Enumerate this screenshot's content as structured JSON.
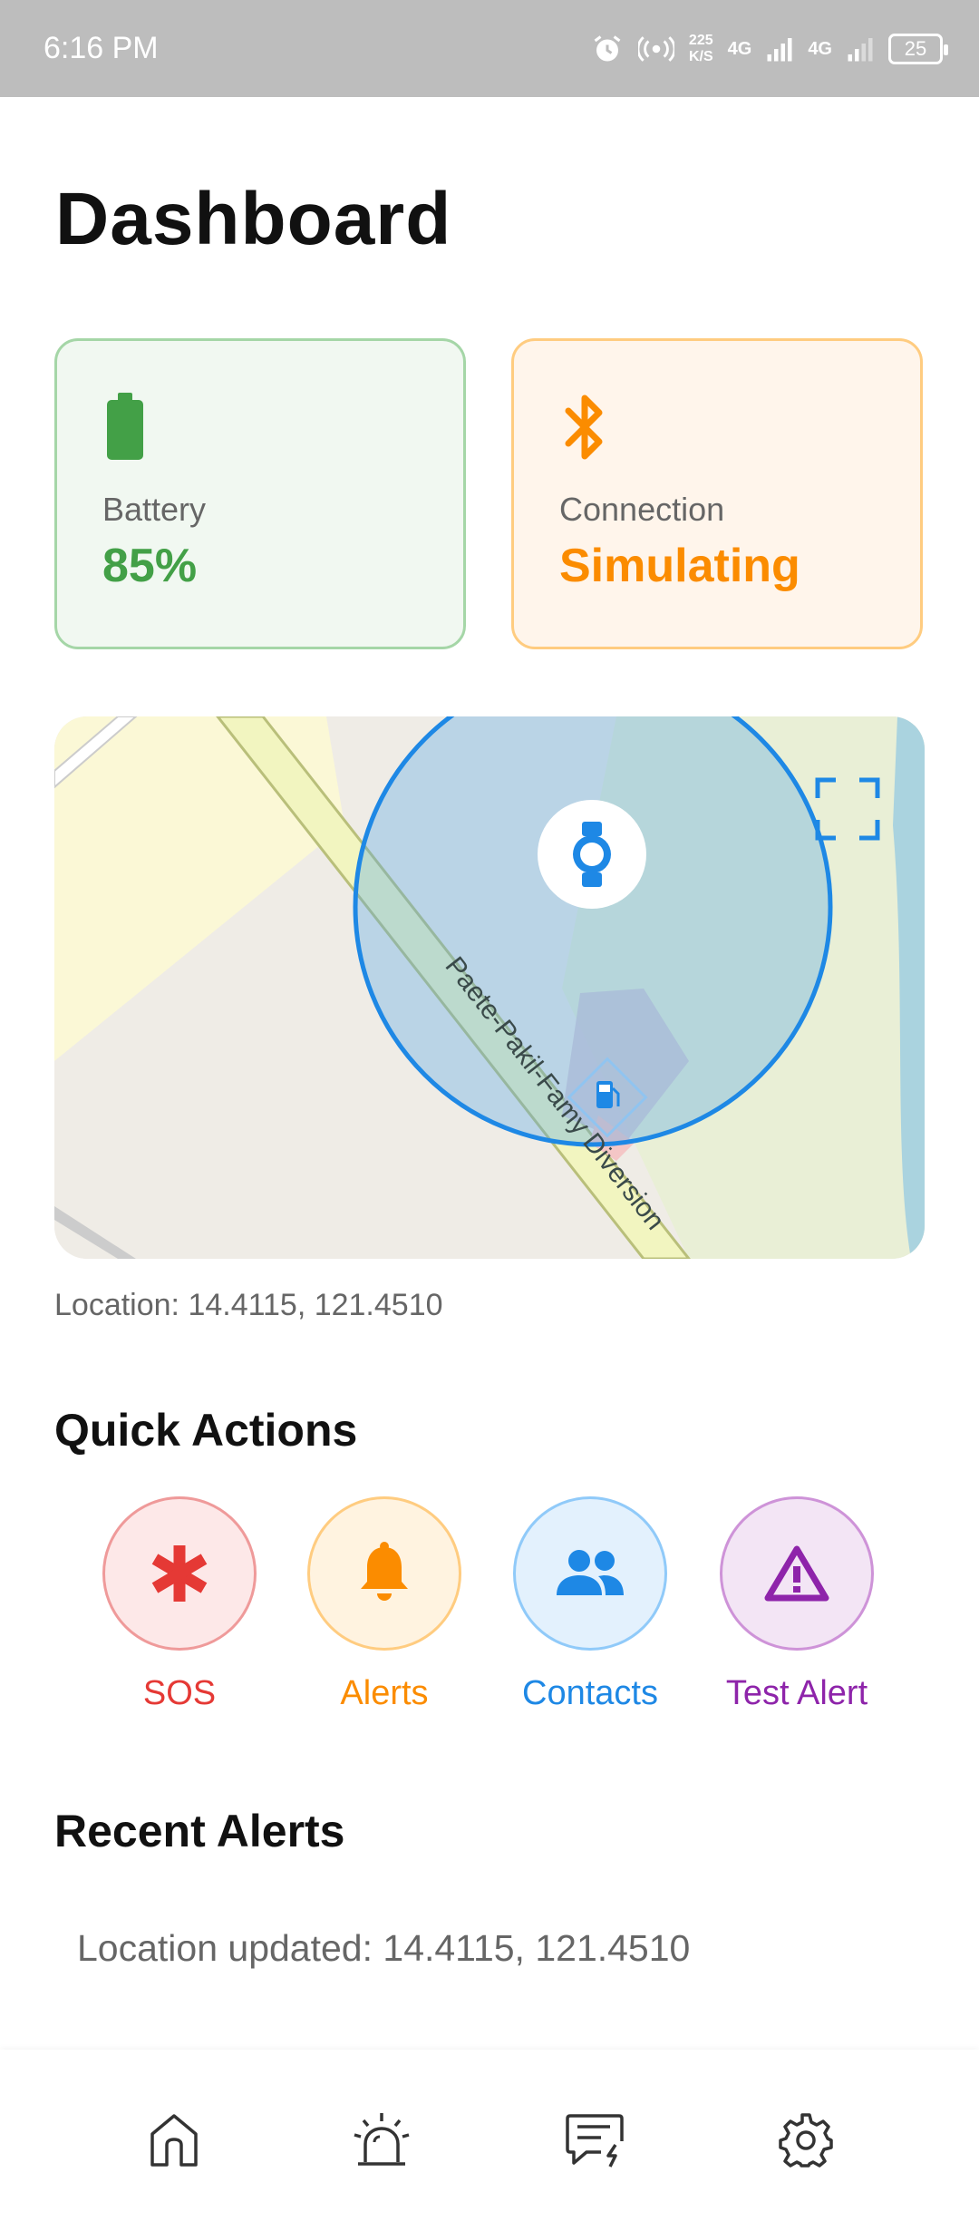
{
  "status_bar": {
    "time": "6:16 PM",
    "speed_value": "225",
    "speed_unit": "K/S",
    "net1": "4G",
    "net2": "4G",
    "battery": "25"
  },
  "page": {
    "title": "Dashboard"
  },
  "cards": {
    "battery": {
      "label": "Battery",
      "value": "85%",
      "icon": "battery-icon",
      "color": "#43a047"
    },
    "connection": {
      "label": "Connection",
      "value": "Simulating",
      "icon": "bluetooth-icon",
      "color": "#fb8c00"
    }
  },
  "map": {
    "road_label": "Paete-Pakil-Famy Diversion",
    "marker_icon": "watch-icon",
    "accent": "#1e88e5"
  },
  "location": {
    "text": "Location: 14.4115, 121.4510"
  },
  "quick_actions": {
    "title": "Quick Actions",
    "items": [
      {
        "label": "SOS",
        "icon": "asterisk-icon",
        "color": "#e53935"
      },
      {
        "label": "Alerts",
        "icon": "bell-icon",
        "color": "#fb8c00"
      },
      {
        "label": "Contacts",
        "icon": "people-icon",
        "color": "#1e88e5"
      },
      {
        "label": "Test Alert",
        "icon": "warning-icon",
        "color": "#8e24aa"
      }
    ]
  },
  "recent_alerts": {
    "title": "Recent Alerts",
    "items": [
      "Location updated: 14.4115, 121.4510"
    ]
  },
  "bottom_nav": {
    "items": [
      {
        "icon": "home-icon"
      },
      {
        "icon": "siren-icon"
      },
      {
        "icon": "message-alert-icon"
      },
      {
        "icon": "gear-icon"
      }
    ]
  }
}
